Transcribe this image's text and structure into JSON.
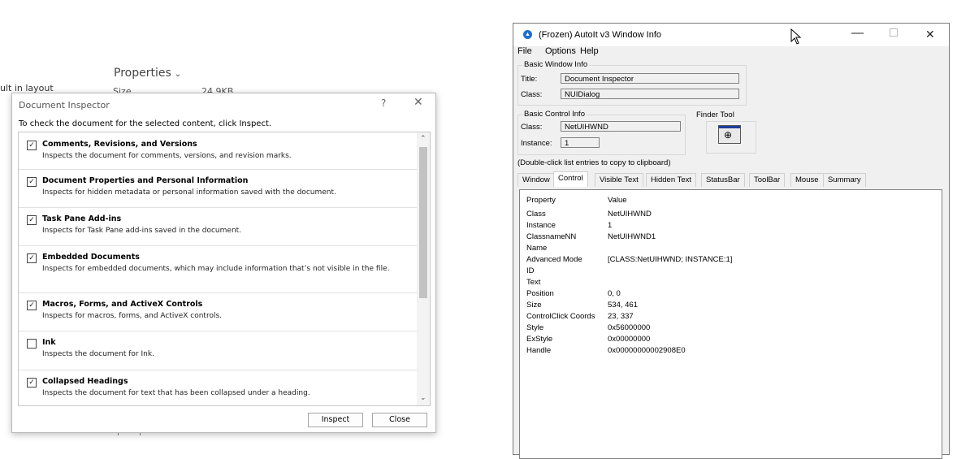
{
  "background": {
    "built_in_layout": "ult in layout",
    "properties_label": "Properties",
    "size_label": "Size",
    "size_value": "24.9KB"
  },
  "doc_inspector": {
    "title": "Document Inspector",
    "help": "?",
    "close": "✕",
    "instructions": "To check the document for the selected content, click Inspect.",
    "items": [
      {
        "name": "Comments, Revisions, and Versions",
        "desc": "Inspects the document for comments, versions, and revision marks.",
        "checked": true
      },
      {
        "name": "Document Properties and Personal Information",
        "desc": "Inspects for hidden metadata or personal information saved with the document.",
        "checked": true
      },
      {
        "name": "Task Pane Add-ins",
        "desc": "Inspects for Task Pane add-ins saved in the document.",
        "checked": true
      },
      {
        "name": "Embedded Documents",
        "desc": "Inspects for embedded documents, which may include information that’s not visible in the file.",
        "checked": true
      },
      {
        "name": "Macros, Forms, and ActiveX Controls",
        "desc": "Inspects for macros, forms, and ActiveX controls.",
        "checked": true
      },
      {
        "name": "Ink",
        "desc": "Inspects the document for Ink.",
        "checked": false
      },
      {
        "name": "Collapsed Headings",
        "desc": "Inspects the document for text that has been collapsed under a heading.",
        "checked": true
      }
    ],
    "inspect_label": "Inspect",
    "close_label": "Close"
  },
  "autoit": {
    "title": "(Frozen) AutoIt v3 Window Info",
    "menu": [
      "File",
      "Options",
      "Help"
    ],
    "basic_window_info": {
      "label": "Basic Window Info",
      "title_label": "Title:",
      "title_value": "Document Inspector",
      "class_label": "Class:",
      "class_value": "NUIDialog"
    },
    "basic_control_info": {
      "label": "Basic Control Info",
      "class_label": "Class:",
      "class_value": "NetUIHWND",
      "instance_label": "Instance:",
      "instance_value": "1"
    },
    "finder_tool_label": "Finder Tool",
    "hint": "(Double-click list entries to copy to clipboard)",
    "tabs": [
      "Window",
      "Control",
      "Visible Text",
      "Hidden Text",
      "StatusBar",
      "ToolBar",
      "Mouse",
      "Summary"
    ],
    "active_tab": "Control",
    "table_header": {
      "property": "Property",
      "value": "Value"
    },
    "rows": [
      {
        "property": "Class",
        "value": "NetUIHWND"
      },
      {
        "property": "Instance",
        "value": "1"
      },
      {
        "property": "ClassnameNN",
        "value": "NetUIHWND1"
      },
      {
        "property": "Name",
        "value": ""
      },
      {
        "property": "Advanced Mode",
        "value": "[CLASS:NetUIHWND; INSTANCE:1]"
      },
      {
        "property": "ID",
        "value": ""
      },
      {
        "property": "Text",
        "value": ""
      },
      {
        "property": "Position",
        "value": "0, 0"
      },
      {
        "property": "Size",
        "value": "534, 461"
      },
      {
        "property": "ControlClick Coords",
        "value": "23, 337"
      },
      {
        "property": "Style",
        "value": "0x56000000"
      },
      {
        "property": "ExStyle",
        "value": "0x00000000"
      },
      {
        "property": "Handle",
        "value": "0x00000000002908E0"
      }
    ]
  }
}
